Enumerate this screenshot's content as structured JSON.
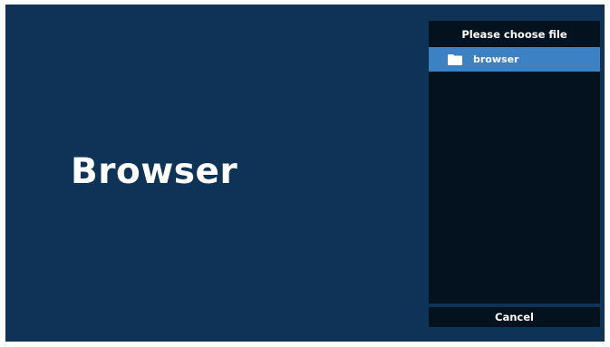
{
  "app": {
    "title": "Browser"
  },
  "file_chooser": {
    "header": "Please choose file",
    "items": [
      {
        "label": "browser",
        "icon": "folder-icon",
        "selected": true
      }
    ],
    "cancel_label": "Cancel"
  },
  "colors": {
    "background": "#0f3357",
    "panel": "#04111e",
    "selection": "#3b81c3",
    "text": "#ffffff"
  }
}
